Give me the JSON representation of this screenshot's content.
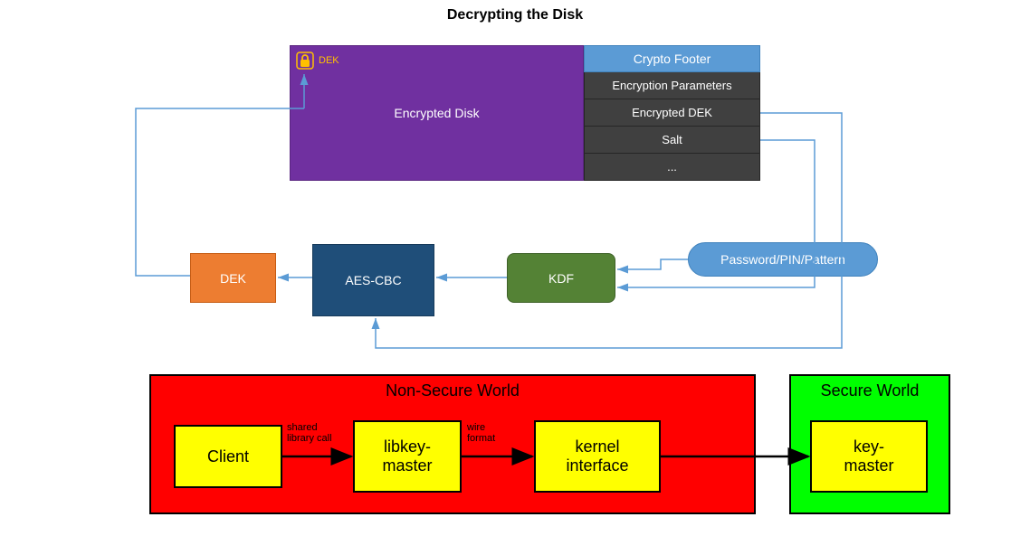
{
  "title": "Decrypting the Disk",
  "disk": {
    "label": "Encrypted Disk",
    "dek_badge": "DEK"
  },
  "footer": {
    "header": "Crypto Footer",
    "rows": [
      "Encryption Parameters",
      "Encrypted DEK",
      "Salt",
      "..."
    ]
  },
  "middle": {
    "dek": "DEK",
    "aes": "AES-CBC",
    "kdf": "KDF",
    "password": "Password/PIN/Pattern"
  },
  "nonsecure": {
    "title": "Non-Secure World",
    "boxes": {
      "client": "Client",
      "libkeymaster": "libkey-\nmaster",
      "kernel": "kernel\ninterface"
    },
    "labels": {
      "shared_call": "shared\nlibrary call",
      "wire_format": "wire\nformat"
    }
  },
  "secure": {
    "title": "Secure World",
    "boxes": {
      "keymaster": "key-\nmaster"
    }
  },
  "colors": {
    "purple": "#7030a0",
    "orange": "#ed7d31",
    "darkblue": "#1f4e79",
    "green_kdf": "#548235",
    "blue": "#5b9bd5",
    "gray": "#404040",
    "red": "#ff0000",
    "green_world": "#00ff00",
    "yellow": "#ffff00",
    "arrow_blue": "#5b9bd5",
    "arrow_black": "#000000"
  }
}
